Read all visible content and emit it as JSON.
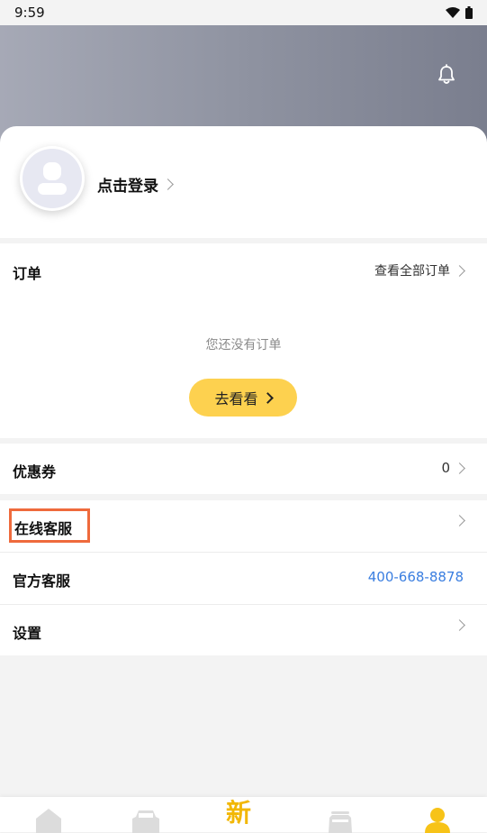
{
  "status_bar": {
    "time": "9:59"
  },
  "profile": {
    "login_text": "点击登录"
  },
  "orders": {
    "title": "订单",
    "view_all": "查看全部订单",
    "empty_text": "您还没有订单",
    "go_button": "去看看"
  },
  "coupons": {
    "title": "优惠券",
    "count": "0"
  },
  "menu": {
    "online_service": "在线客服",
    "official_service": "官方客服",
    "official_phone": "400-668-8878",
    "settings": "设置"
  },
  "tabbar": {
    "items": [
      {
        "icon": "home-icon"
      },
      {
        "icon": "car-icon"
      },
      {
        "label": "新"
      },
      {
        "icon": "vehicle-icon"
      },
      {
        "icon": "user-icon"
      }
    ],
    "active_color": "#f2b705"
  },
  "colors": {
    "accent_yellow": "#fdd14f",
    "link_blue": "#3a7ee0",
    "highlight_orange": "#ef6a3c"
  }
}
